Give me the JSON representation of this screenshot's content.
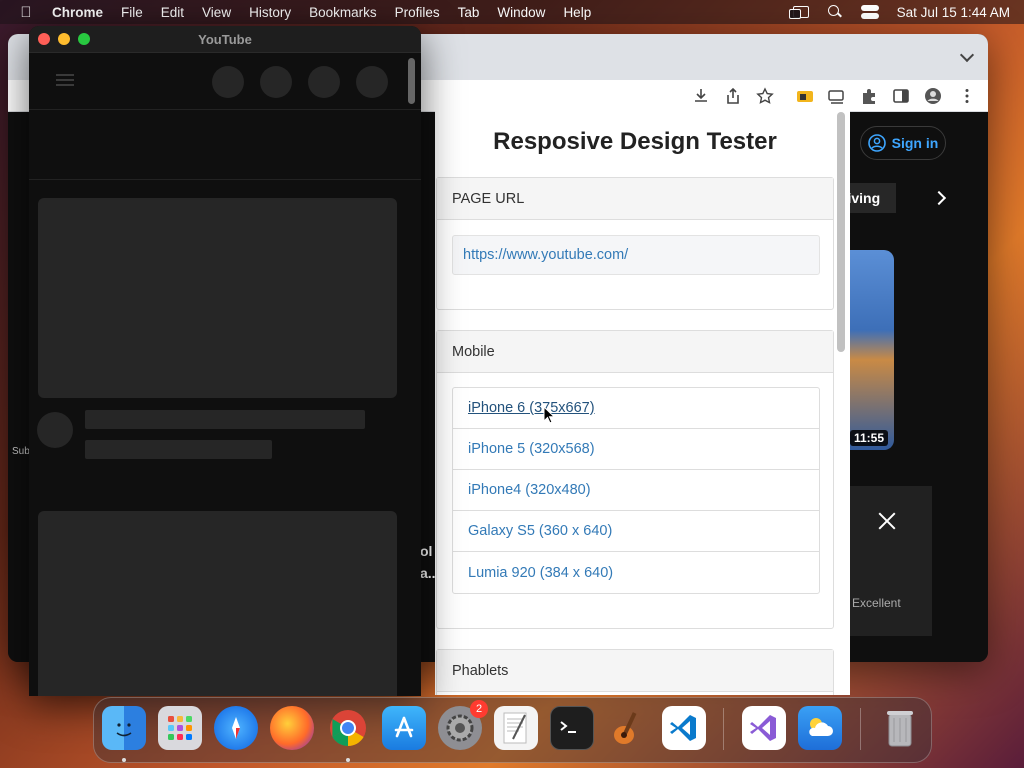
{
  "menubar": {
    "app_name": "Chrome",
    "items": [
      "File",
      "Edit",
      "View",
      "History",
      "Bookmarks",
      "Profiles",
      "Tab",
      "Window",
      "Help"
    ],
    "clock": "Sat Jul 15  1:44 AM"
  },
  "youtube_window": {
    "title": "YouTube"
  },
  "background_youtube": {
    "signin_label": "Sign in",
    "chip_label": "riving",
    "duration": "11:55",
    "dialog_text": "Excellent",
    "side_text": "Sub",
    "partial_title": [
      "ol f",
      "a..."
    ]
  },
  "rdt": {
    "title": "Resposive Design Tester",
    "url_section": {
      "header": "PAGE URL",
      "url": "https://www.youtube.com/"
    },
    "mobile_section": {
      "header": "Mobile",
      "devices": [
        "iPhone 6 (375x667)",
        "iPhone 5 (320x568)",
        "iPhone4 (320x480)",
        "Galaxy S5 (360 x 640)",
        "Lumia 920 (384 x 640)"
      ]
    },
    "phablets_section": {
      "header": "Phablets"
    }
  },
  "dock": {
    "apps": [
      "Finder",
      "Launchpad",
      "Safari",
      "Firefox",
      "Chrome",
      "App Store",
      "System Settings",
      "TextEdit",
      "Terminal",
      "GarageBand",
      "Visual Studio Code",
      "Visual Studio",
      "Weather",
      "Trash"
    ],
    "settings_badge": "2"
  }
}
